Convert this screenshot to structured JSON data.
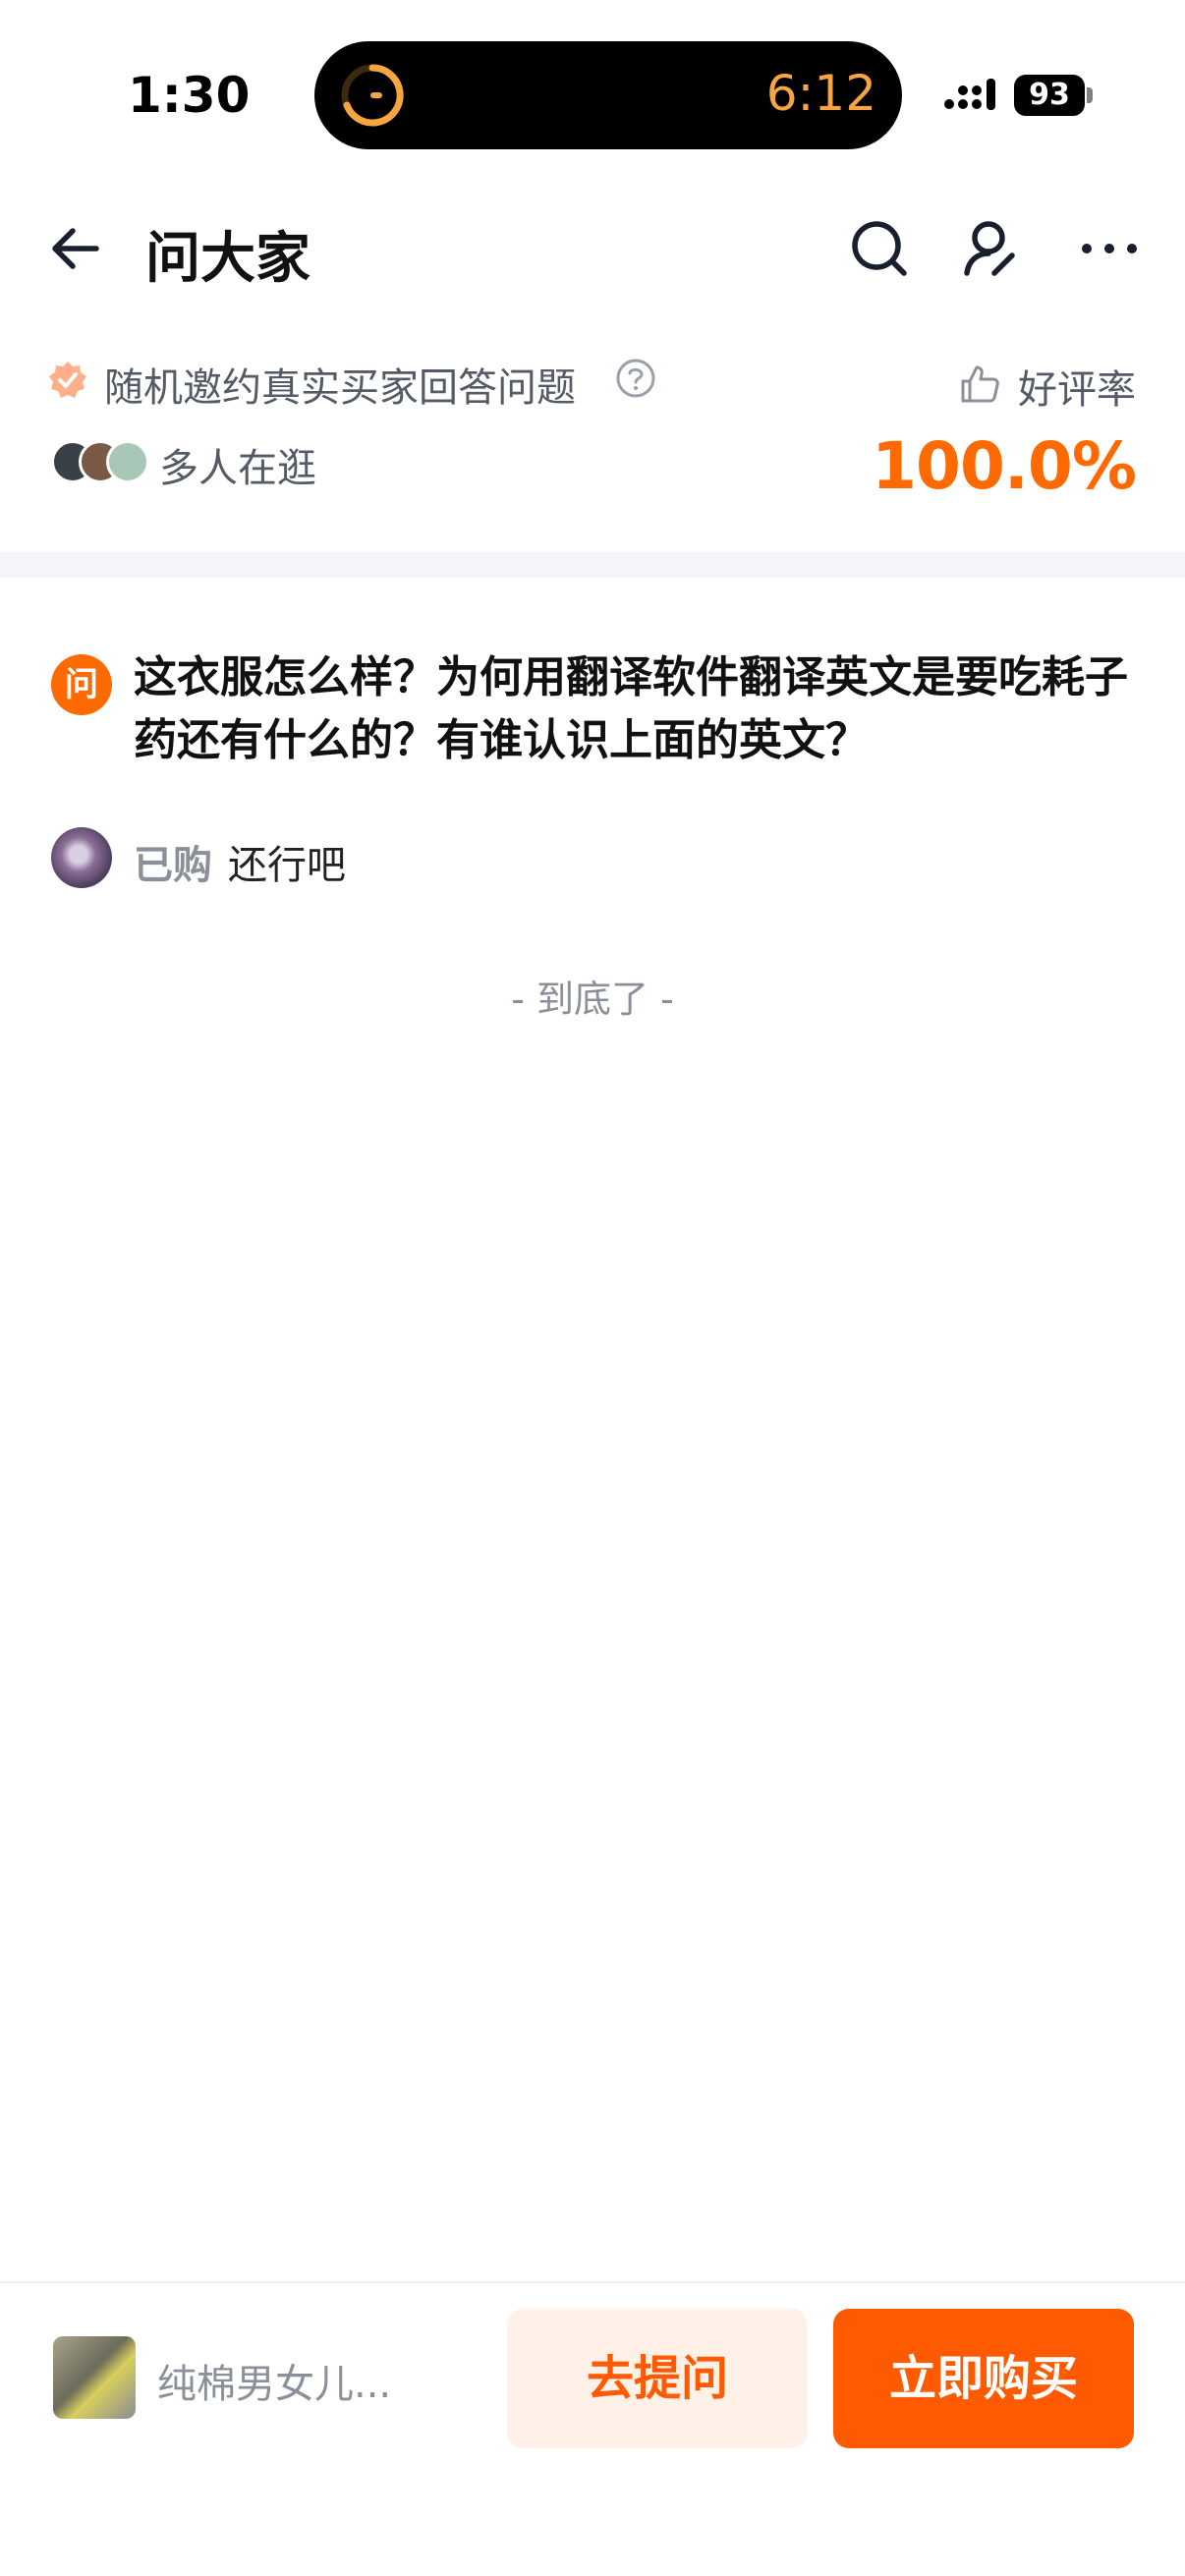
{
  "status_bar": {
    "time": "1:30",
    "island_timer": "6:12",
    "battery": "93"
  },
  "nav": {
    "title": "问大家"
  },
  "info": {
    "invite_text": "随机邀约真实买家回答问题",
    "browsing_text": "多人在逛",
    "rate_label": "好评率",
    "rate_value": "100.0%"
  },
  "question": {
    "badge": "问",
    "text": "这衣服怎么样？为何用翻译软件翻译英文是要吃耗子药还有什么的？有谁认识上面的英文？"
  },
  "answer": {
    "tag": "已购",
    "text": "还行吧"
  },
  "end_text": "- 到底了 -",
  "bottom": {
    "product_name": "纯棉男女儿...",
    "ask_button": "去提问",
    "buy_button": "立即购买"
  },
  "colors": {
    "accent": "#ff6a00",
    "timer": "#f7a540"
  }
}
